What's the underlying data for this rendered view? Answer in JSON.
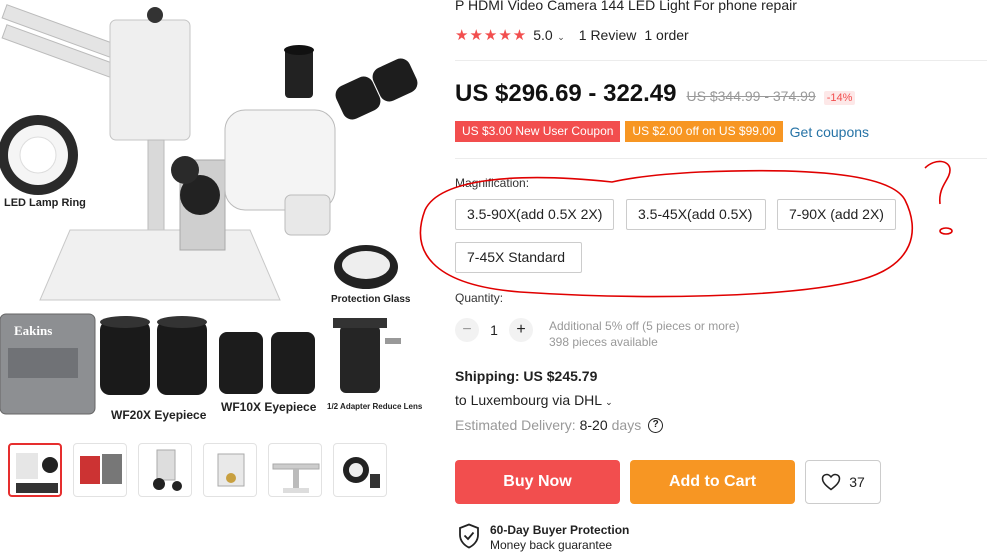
{
  "product": {
    "title": "P HDMI Video Camera 144 LED Light For phone repair",
    "stars": "★★★★★",
    "rating": "5.0",
    "reviews": "1 Review",
    "orders": "1 order"
  },
  "price": {
    "current": "US $296.69 - 322.49",
    "original": "US $344.99 - 374.99",
    "discount": "-14%"
  },
  "coupons": {
    "new_user": "US $3.00 New User Coupon",
    "store": "US $2.00 off on US $99.00",
    "link": "Get coupons"
  },
  "sku": {
    "label": "Magnification:",
    "options": [
      "3.5-90X(add 0.5X 2X)",
      "3.5-45X(add 0.5X)",
      "7-90X (add 2X)",
      "7-45X Standard"
    ]
  },
  "quantity": {
    "label": "Quantity:",
    "minus": "−",
    "plus": "+",
    "value": "1",
    "discount_note": "Additional 5% off (5 pieces or more)",
    "available": "398 pieces available"
  },
  "shipping": {
    "cost": "Shipping: US $245.79",
    "destination": "to Luxembourg via DHL",
    "delivery_label": "Estimated Delivery:",
    "delivery_days": "8-20",
    "delivery_unit": "days",
    "help_glyph": "?"
  },
  "actions": {
    "buy_now": "Buy Now",
    "add_to_cart": "Add to Cart",
    "wishlist_count": "37"
  },
  "protection": {
    "title": "60-Day Buyer Protection",
    "subtitle": "Money back guarantee"
  },
  "gallery": {
    "labels": {
      "lamp": "LED Lamp Ring",
      "glass": "Protection Glass",
      "wf20": "WF20X Eyepiece",
      "wf10": "WF10X Eyepiece",
      "adapter": "1/2 Adapter Reduce Lens"
    },
    "thumbnail_count": 6,
    "active_thumbnail": 1
  },
  "colors": {
    "accent_red": "#f24e4e",
    "accent_orange": "#f79623",
    "link_blue": "#2673a6",
    "annotation_red": "#e00000"
  },
  "icons": {
    "heart": "heart-icon",
    "shield": "shield-check-icon",
    "help": "help-circle-icon",
    "caret": "chevron-down-icon"
  }
}
